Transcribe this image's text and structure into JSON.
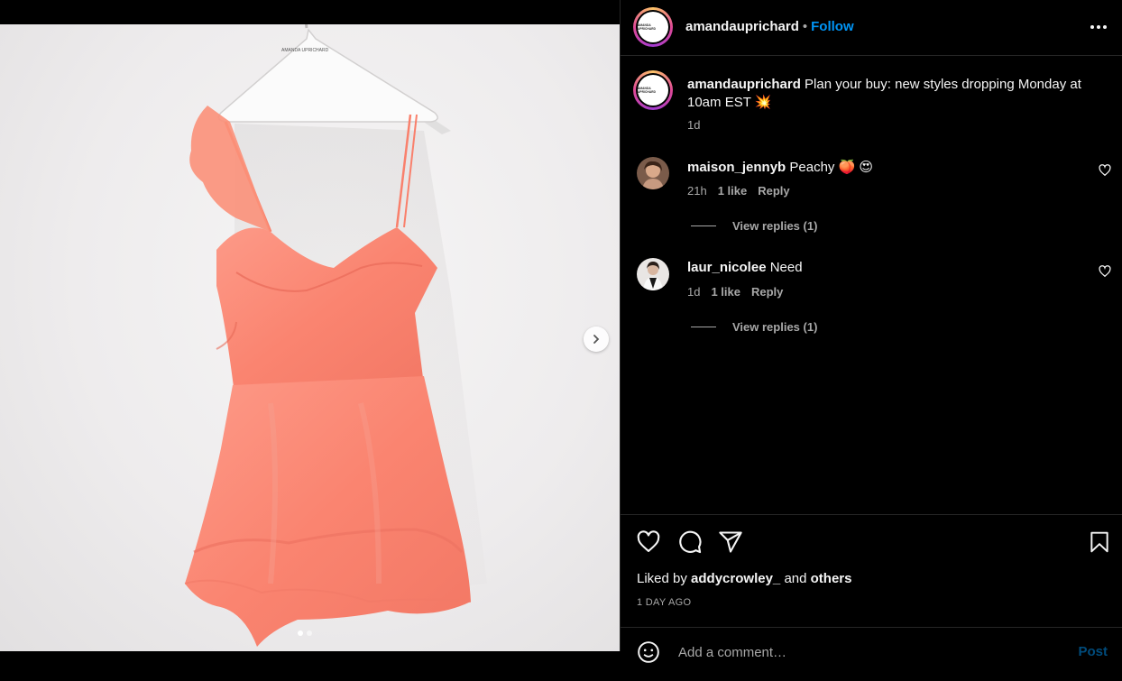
{
  "post": {
    "image_alt": "Coral ruffled mini dress on a white hanger",
    "carousel": {
      "total": 2,
      "current": 1
    }
  },
  "header": {
    "username": "amandauprichard",
    "separator": "•",
    "follow_label": "Follow",
    "brand_logo_text": "AMANDA UPRICHARD"
  },
  "caption": {
    "username": "amandauprichard",
    "text": "Plan your buy: new styles dropping Monday at 10am EST 💥",
    "time": "1d"
  },
  "comments": [
    {
      "username": "maison_jennyb",
      "text": "Peachy 🍑 😍",
      "time": "21h",
      "likes": "1 like",
      "reply_label": "Reply",
      "view_replies": "View replies (1)"
    },
    {
      "username": "laur_nicolee",
      "text": "Need",
      "time": "1d",
      "likes": "1 like",
      "reply_label": "Reply",
      "view_replies": "View replies (1)"
    }
  ],
  "actions": {
    "liked_by_prefix": "Liked by",
    "liked_by_user": "addycrowley_",
    "liked_by_and": "and",
    "liked_by_others": "others",
    "post_date": "1 DAY AGO"
  },
  "add_comment": {
    "placeholder": "Add a comment…",
    "post_label": "Post"
  },
  "icons": {
    "more": "more-options-icon",
    "like": "heart-icon",
    "comment": "comment-icon",
    "share": "share-icon",
    "save": "bookmark-icon",
    "next": "chevron-right-icon",
    "emoji": "emoji-icon"
  },
  "colors": {
    "background": "#000000",
    "accent": "#0095f6",
    "secondary_text": "#a8a8a8",
    "divider": "#262626",
    "dress": "#fa8a7a"
  }
}
